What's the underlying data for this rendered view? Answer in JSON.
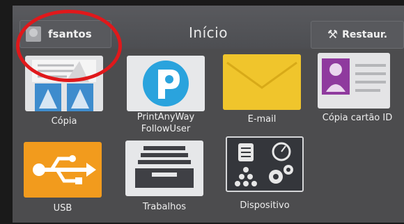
{
  "header": {
    "user_name": "fsantos",
    "title": "Início",
    "restore_label": "Restaur.",
    "restore_icon": "wrench-icon"
  },
  "apps": [
    {
      "label": "Cópia",
      "icon": "copy-icon"
    },
    {
      "label": "PrintAnyWay\nFollowUser",
      "icon": "printanyway-icon"
    },
    {
      "label": "E-mail",
      "icon": "envelope-icon"
    },
    {
      "label": "Cópia cartão ID",
      "icon": "id-card-icon"
    },
    {
      "label": "USB",
      "icon": "usb-icon"
    },
    {
      "label": "Trabalhos",
      "icon": "job-tray-icon"
    },
    {
      "label": "Dispositivo",
      "icon": "device-icon"
    }
  ],
  "colors": {
    "screen_bg": "#4c4c4e",
    "email_tile": "#f0c52c",
    "usb_tile": "#f29b1d",
    "printanyway_blue": "#2aa3dd",
    "annotation_red": "#e0181b"
  }
}
